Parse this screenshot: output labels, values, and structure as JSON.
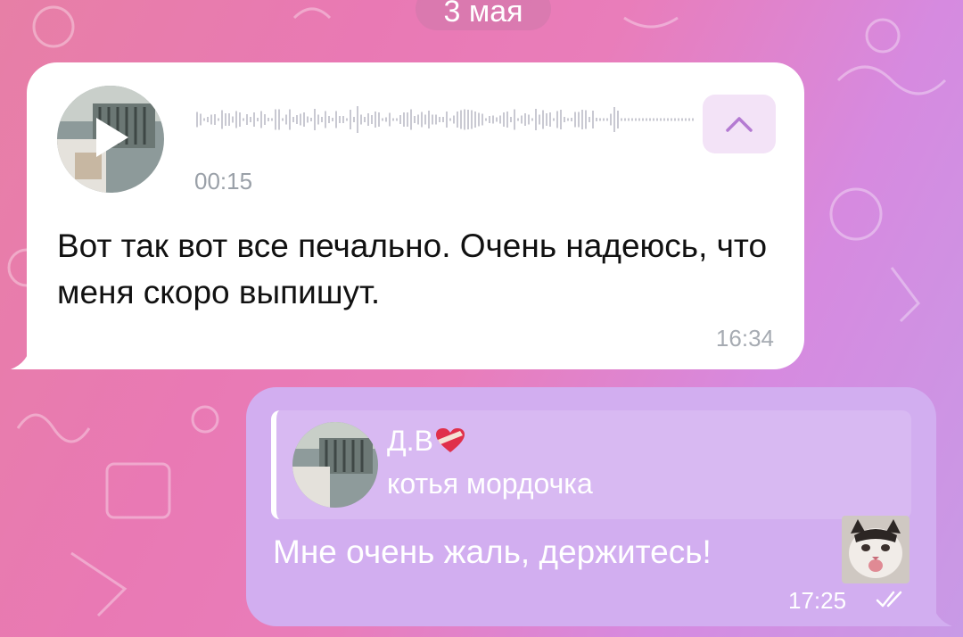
{
  "date_separator": "3 мая",
  "incoming": {
    "video_duration": "00:15",
    "text": "Вот так вот все печально. Очень надеюсь, что меня скоро выпишут.",
    "time": "16:34",
    "icons": {
      "play": "play-icon",
      "collapse": "chevron-up-icon",
      "waveform": "waveform-icon"
    }
  },
  "outgoing": {
    "reply": {
      "author": "Д.В",
      "author_emoji": "heart-with-bandage-icon",
      "text": "котья мордочка"
    },
    "text": "Мне очень жаль, держитесь!",
    "sticker": "crying-cat-emoji",
    "time": "17:25",
    "status_icon": "double-check-icon"
  },
  "colors": {
    "background_pink": "#e77fa6",
    "background_purple": "#c89ae6",
    "incoming_bubble": "#ffffff",
    "outgoing_bubble": "#d2aef0",
    "accent": "#c37ad8"
  }
}
